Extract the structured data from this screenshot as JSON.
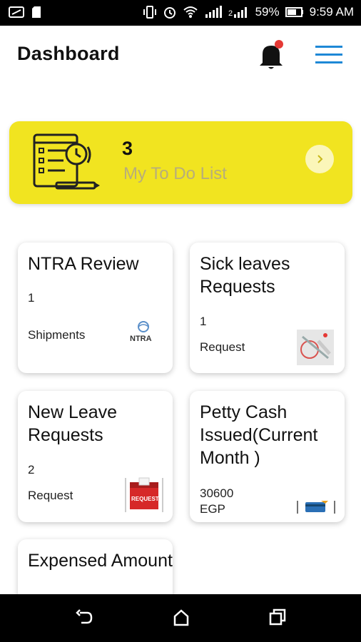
{
  "status_bar": {
    "battery": "59%",
    "time": "9:59 AM"
  },
  "header": {
    "title": "Dashboard"
  },
  "todo": {
    "count": "3",
    "label": "My To Do List"
  },
  "tiles": [
    {
      "title": "NTRA Review",
      "value": "1",
      "unit": "Shipments",
      "logo_text": "NTRA"
    },
    {
      "title": "Sick leaves Requests",
      "value": "1",
      "unit": "Request"
    },
    {
      "title": "New Leave Requests",
      "value": "2",
      "unit": "Request",
      "logo_text": "REQUEST"
    },
    {
      "title": "Petty Cash Issued(Current Month )",
      "value": "30600",
      "unit": "EGP"
    },
    {
      "title": "Expensed Amount"
    }
  ],
  "colors": {
    "accent_yellow": "#f1e420",
    "menu_blue": "#1e88d6",
    "notification_red": "#e53935"
  }
}
